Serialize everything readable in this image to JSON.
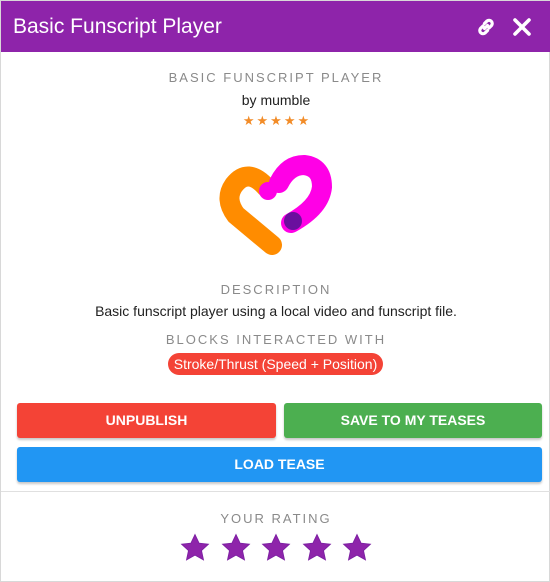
{
  "titlebar": {
    "title": "Basic Funscript Player",
    "link_icon": "link-icon",
    "close_icon": "close-icon"
  },
  "app": {
    "name": "BASIC FUNSCRIPT PLAYER",
    "author": "by mumble",
    "stars": [
      "★",
      "★",
      "★",
      "★",
      "★"
    ],
    "rating": 5
  },
  "description": {
    "label": "DESCRIPTION",
    "text": "Basic funscript player using a local video and funscript file."
  },
  "blocks": {
    "label": "BLOCKS INTERACTED WITH",
    "chip": "Stroke/Thrust (Speed + Position)"
  },
  "buttons": {
    "unpublish": "UNPUBLISH",
    "save": "SAVE TO MY TEASES",
    "load": "LOAD TEASE"
  },
  "your_rating": {
    "label": "YOUR RATING",
    "value": 5
  },
  "colors": {
    "titlebar": "#8e24aa",
    "unpublish": "#f44336",
    "save": "#4caf50",
    "load": "#2196f3",
    "star_small": "#f28c28",
    "star_rating": "#8e24aa",
    "logo_orange": "#ff8c00",
    "logo_magenta": "#ff00e6",
    "logo_purple": "#6a0f9e"
  }
}
